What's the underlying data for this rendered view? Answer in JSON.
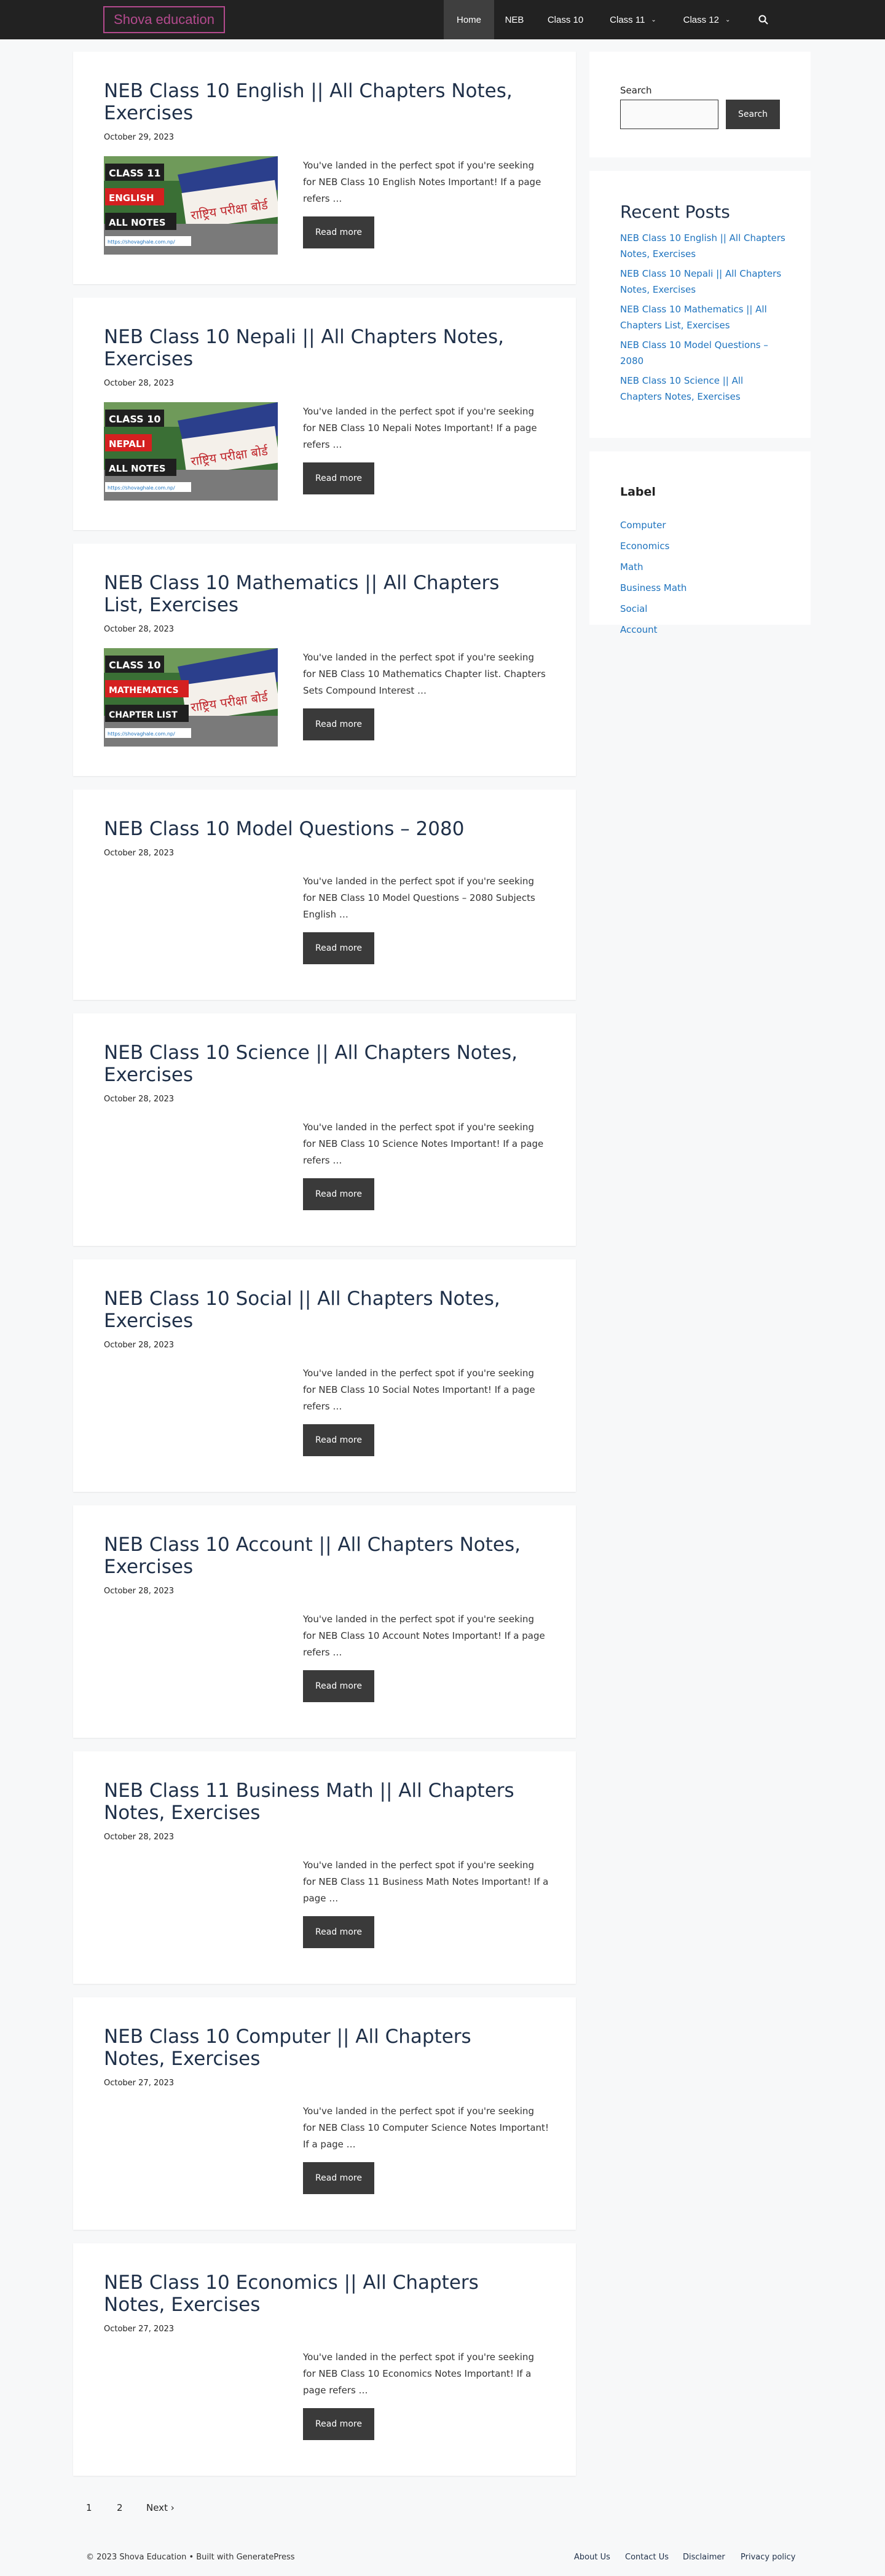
{
  "header": {
    "logo": "Shova education",
    "nav": [
      {
        "label": "Home",
        "active": true,
        "dropdown": false
      },
      {
        "label": "NEB",
        "active": false,
        "dropdown": false
      },
      {
        "label": "Class 10",
        "active": false,
        "dropdown": false
      },
      {
        "label": "Class 11",
        "active": false,
        "dropdown": true
      },
      {
        "label": "Class 12",
        "active": false,
        "dropdown": true
      }
    ],
    "search_icon": "search-icon"
  },
  "posts": [
    {
      "title": "NEB Class 10 English || All Chapters Notes, Exercises",
      "date": "October 29, 2023",
      "excerpt": "You've landed in the perfect spot if you're seeking for NEB Class 10 English Notes Important! If a page refers …",
      "thumb": {
        "line1": "CLASS 11",
        "line2": "ENGLISH",
        "line3": "ALL NOTES",
        "banner": "राष्ट्रिय परीक्षा बोर्ड",
        "url": "https://shovaghale.com.np/"
      }
    },
    {
      "title": "NEB Class 10 Nepali || All Chapters Notes, Exercises",
      "date": "October 28, 2023",
      "excerpt": "You've landed in the perfect spot if you're seeking for NEB Class 10 Nepali Notes Important! If a page refers …",
      "thumb": {
        "line1": "CLASS 10",
        "line2": "NEPALI",
        "line3": "ALL NOTES",
        "banner": "राष्ट्रिय परीक्षा बोर्ड",
        "url": "https://shovaghale.com.np/"
      }
    },
    {
      "title": "NEB Class 10 Mathematics || All Chapters List, Exercises",
      "date": "October 28, 2023",
      "excerpt": "You've landed in the perfect spot if you're seeking for NEB Class 10 Mathematics Chapter list. Chapters Sets Compound Interest …",
      "thumb": {
        "line1": "CLASS 10",
        "line2": "MATHEMATICS",
        "line3": "CHAPTER LIST",
        "banner": "राष्ट्रिय परीक्षा बोर्ड",
        "url": "https://shovaghale.com.np/"
      }
    },
    {
      "title": "NEB Class 10 Model Questions – 2080",
      "date": "October 28, 2023",
      "excerpt": "You've landed in the perfect spot if you're seeking for NEB Class 10 Model Questions – 2080 Subjects English  …",
      "thumb": null
    },
    {
      "title": "NEB Class 10 Science || All Chapters Notes, Exercises",
      "date": "October 28, 2023",
      "excerpt": "You've landed in the perfect spot if you're seeking for NEB Class 10 Science Notes Important! If a page refers …",
      "thumb": null
    },
    {
      "title": "NEB Class 10 Social || All Chapters Notes, Exercises",
      "date": "October 28, 2023",
      "excerpt": "You've landed in the perfect spot if you're seeking for NEB Class 10 Social Notes Important! If a page refers …",
      "thumb": null
    },
    {
      "title": "NEB Class 10 Account || All Chapters Notes, Exercises",
      "date": "October 28, 2023",
      "excerpt": "You've landed in the perfect spot if you're seeking for NEB Class 10 Account Notes Important! If a page refers …",
      "thumb": null
    },
    {
      "title": "NEB Class 11 Business Math || All Chapters Notes, Exercises",
      "date": "October 28, 2023",
      "excerpt": "You've landed in the perfect spot if you're seeking for NEB Class 11 Business Math Notes Important! If a page …",
      "thumb": null
    },
    {
      "title": "NEB Class 10 Computer || All Chapters Notes, Exercises",
      "date": "October 27, 2023",
      "excerpt": "You've landed in the perfect spot if you're seeking for NEB Class 10 Computer Science Notes Important! If a page …",
      "thumb": null
    },
    {
      "title": "NEB Class 10 Economics || All Chapters Notes, Exercises",
      "date": "October 27, 2023",
      "excerpt": "You've landed in the perfect spot if you're seeking for NEB Class 10 Economics Notes Important! If a page refers …",
      "thumb": null
    }
  ],
  "read_more_label": "Read more",
  "sidebar": {
    "search": {
      "label": "Search",
      "button": "Search",
      "value": ""
    },
    "recent": {
      "heading": "Recent Posts",
      "items": [
        "NEB Class 10 English || All Chapters Notes, Exercises",
        "NEB Class 10 Nepali || All Chapters Notes, Exercises",
        "NEB Class 10 Mathematics || All Chapters List, Exercises",
        "NEB Class 10 Model Questions – 2080",
        "NEB Class 10 Science || All Chapters Notes, Exercises"
      ]
    },
    "labels": {
      "heading": "Label",
      "items": [
        "Computer",
        "Economics",
        "Math",
        "Business Math",
        "Social",
        "Account"
      ]
    }
  },
  "pagination": {
    "page1": "1",
    "page2": "2",
    "next": "Next",
    "next_icon": "chevron-right-icon"
  },
  "footer": {
    "copyright": "© 2023 Shova Education • Built with GeneratePress",
    "links": [
      "About Us",
      "Contact Us",
      "Disclaimer",
      "Privacy policy"
    ]
  },
  "colors": {
    "header_bg": "#222222",
    "link": "#1e73be",
    "title": "#1f3049",
    "logo": "#b44a8e"
  }
}
